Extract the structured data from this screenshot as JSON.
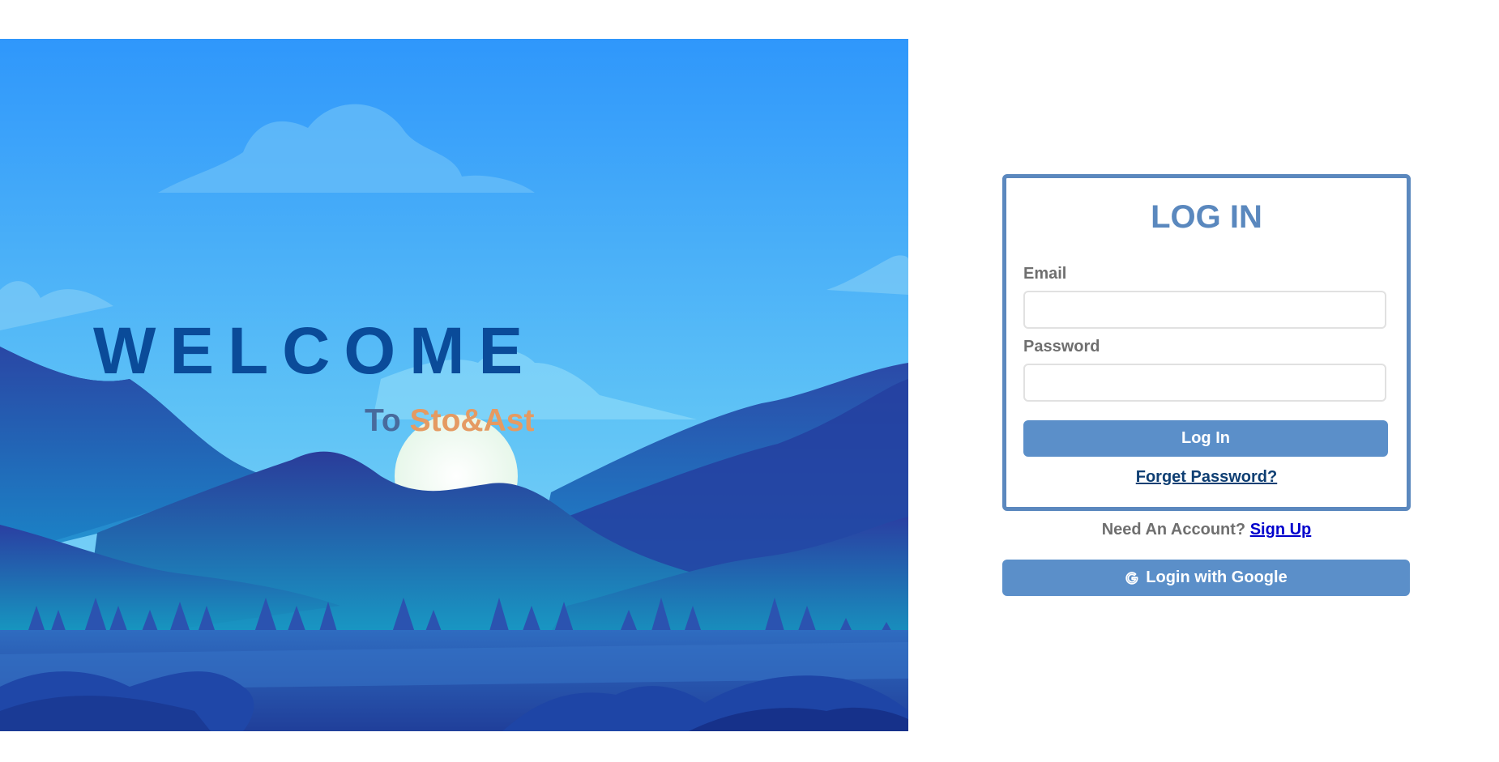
{
  "hero": {
    "welcome": "WELCOME",
    "to": "To",
    "brand": "Sto&Ast"
  },
  "login": {
    "title": "LOG IN",
    "email_label": "Email",
    "email_value": "",
    "password_label": "Password",
    "password_value": "",
    "submit_label": "Log In",
    "forget_label": "Forget Password?"
  },
  "signup": {
    "prompt": "Need An Account?",
    "link_label": "Sign Up"
  },
  "google": {
    "label": "Login with Google",
    "icon": "google-g-icon"
  },
  "colors": {
    "accent": "#5b8fc9",
    "border": "#5b88be",
    "title": "#5a88be",
    "welcome": "#0a4b99",
    "brand": "#e59a62"
  }
}
